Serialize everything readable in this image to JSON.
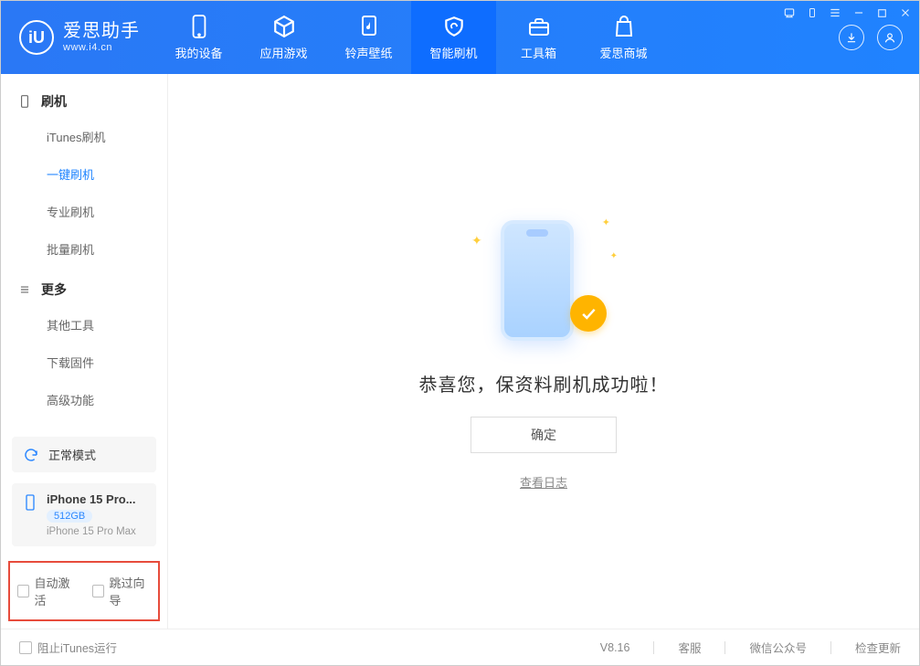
{
  "brand": {
    "title": "爱思助手",
    "subtitle": "www.i4.cn",
    "logo_letter": "iU"
  },
  "tabs": [
    {
      "id": "device",
      "label": "我的设备"
    },
    {
      "id": "apps",
      "label": "应用游戏"
    },
    {
      "id": "ringtone",
      "label": "铃声壁纸"
    },
    {
      "id": "flash",
      "label": "智能刷机"
    },
    {
      "id": "toolbox",
      "label": "工具箱"
    },
    {
      "id": "store",
      "label": "爱思商城"
    }
  ],
  "sidebar": {
    "group1": {
      "title": "刷机",
      "items": [
        {
          "label": "iTunes刷机"
        },
        {
          "label": "一键刷机"
        },
        {
          "label": "专业刷机"
        },
        {
          "label": "批量刷机"
        }
      ]
    },
    "group2": {
      "title": "更多",
      "items": [
        {
          "label": "其他工具"
        },
        {
          "label": "下载固件"
        },
        {
          "label": "高级功能"
        }
      ]
    }
  },
  "device": {
    "mode_label": "正常模式",
    "name": "iPhone 15 Pro...",
    "storage": "512GB",
    "model": "iPhone 15 Pro Max"
  },
  "checks": {
    "auto_activate": "自动激活",
    "skip_guide": "跳过向导"
  },
  "main": {
    "success_message": "恭喜您，保资料刷机成功啦！",
    "ok_button": "确定",
    "view_log": "查看日志"
  },
  "footer": {
    "block_itunes": "阻止iTunes运行",
    "version": "V8.16",
    "support": "客服",
    "wechat": "微信公众号",
    "update": "检查更新"
  }
}
